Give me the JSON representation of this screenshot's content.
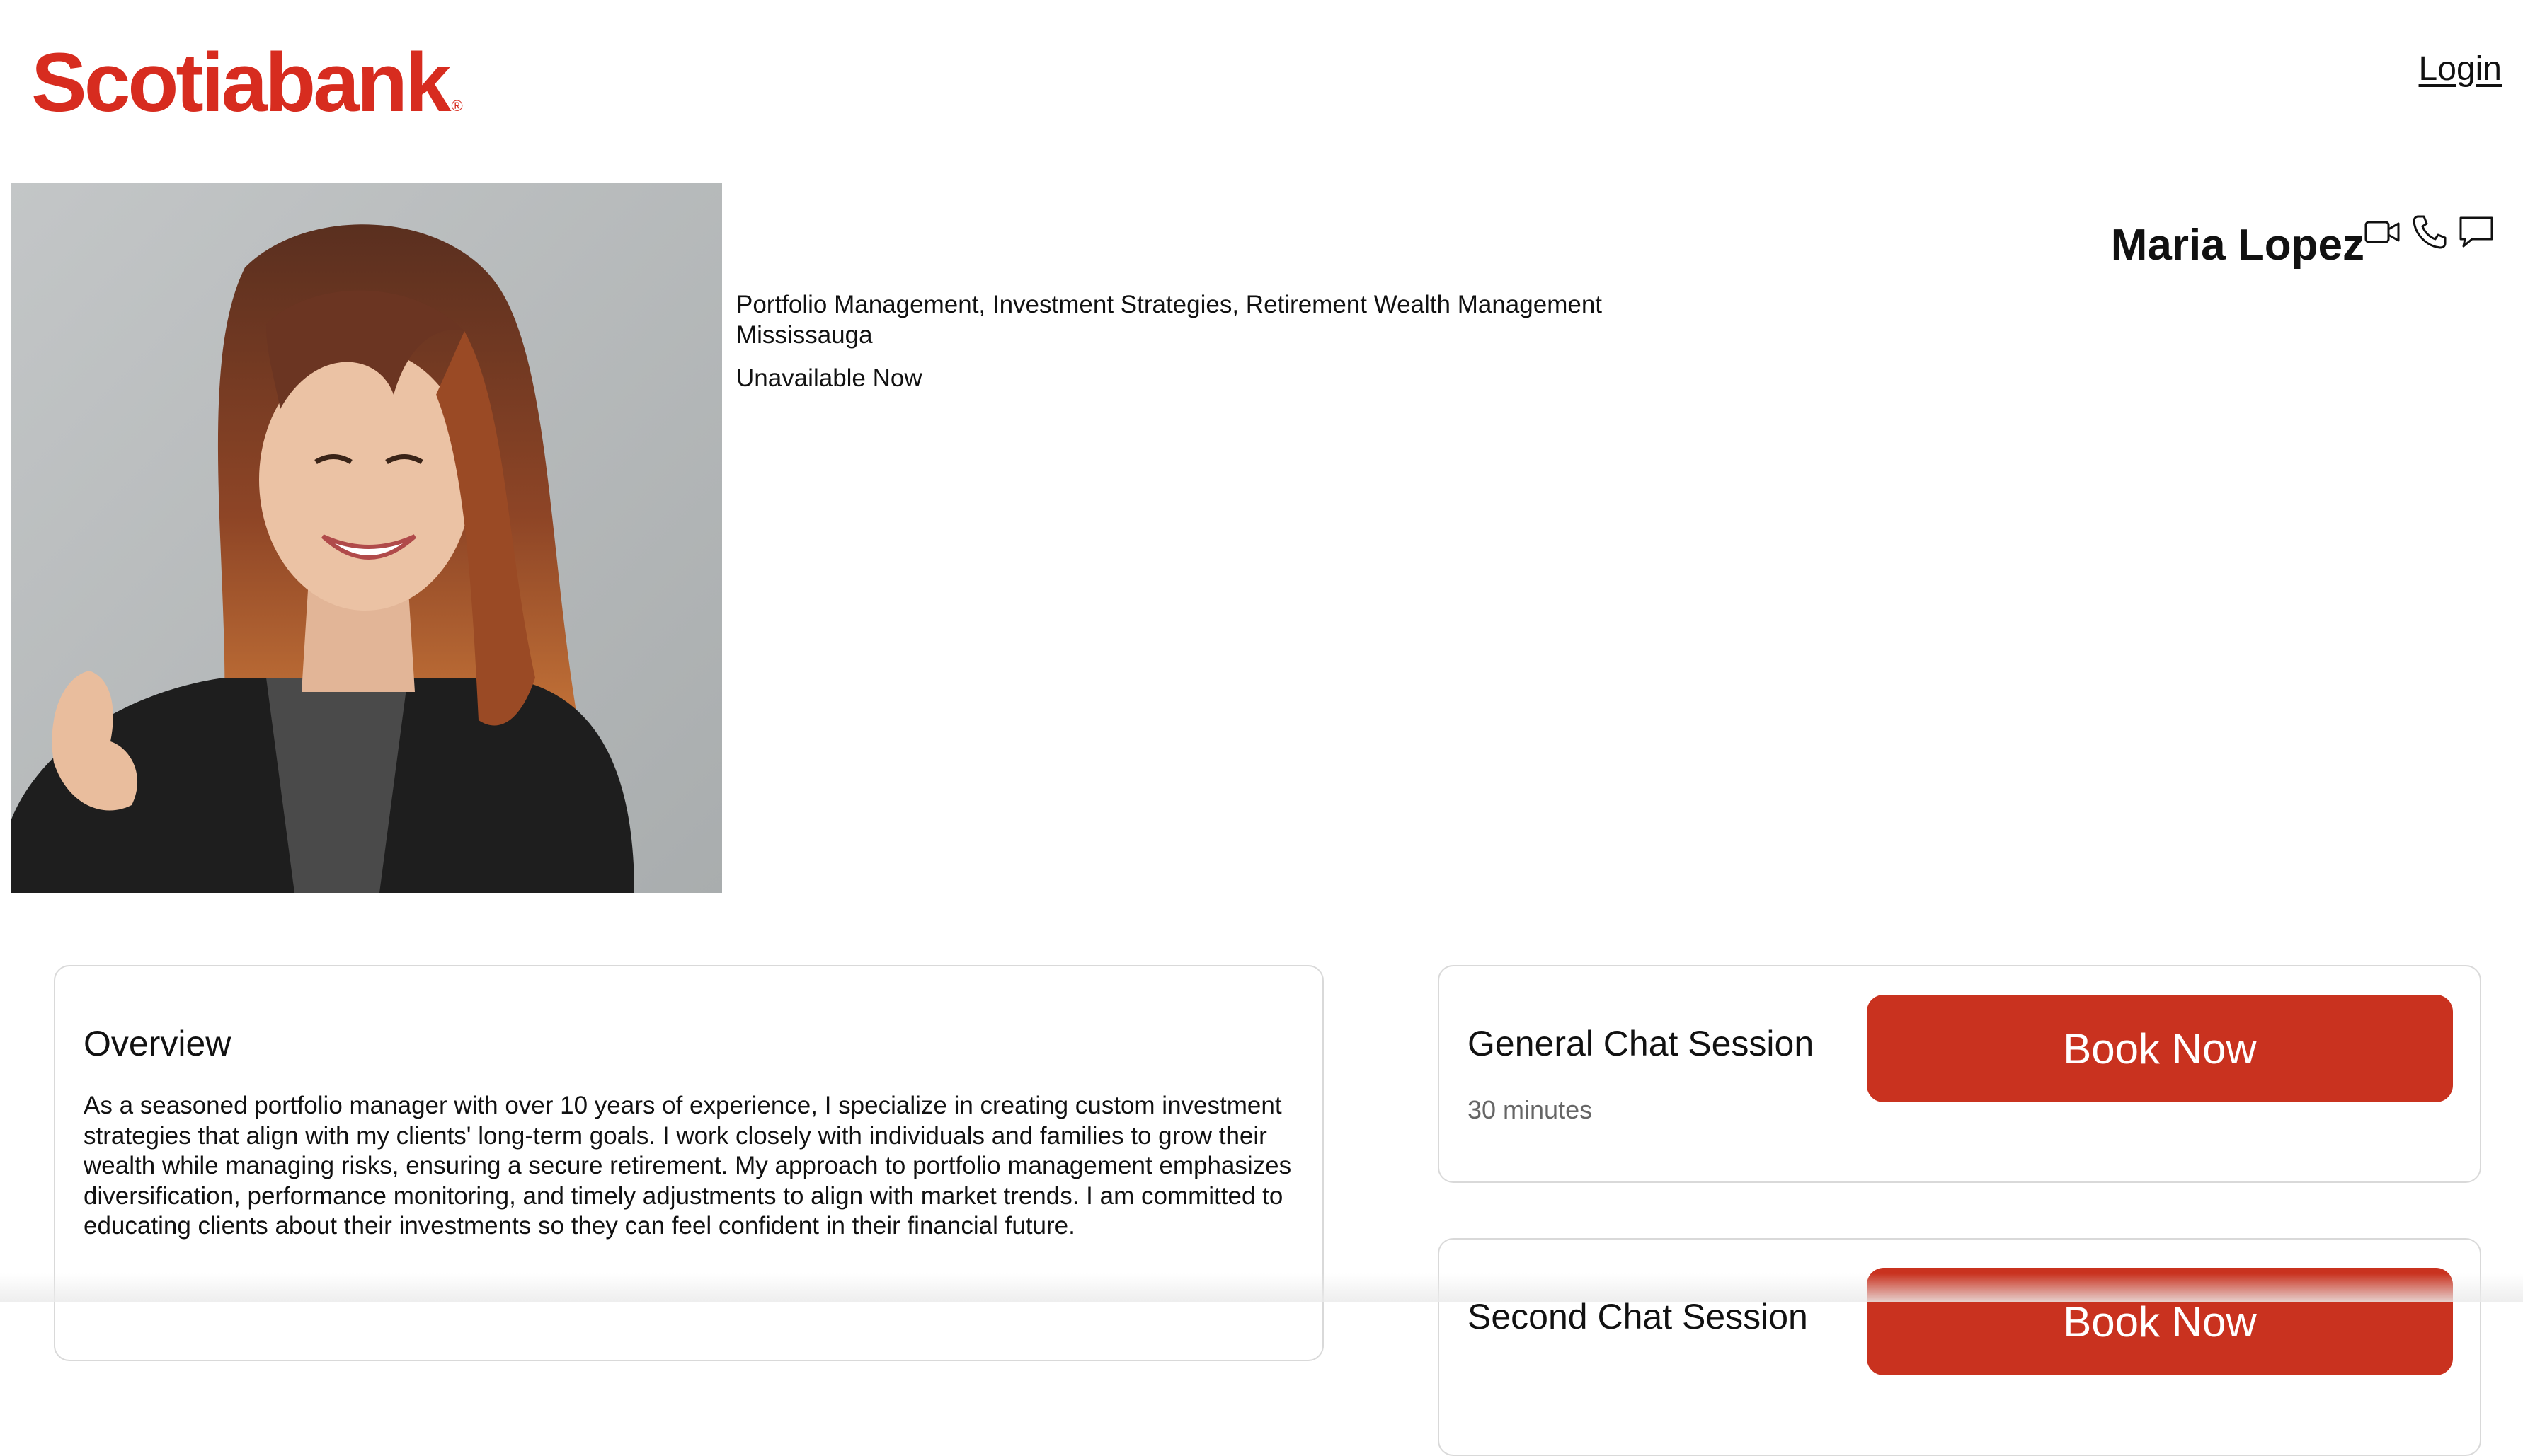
{
  "header": {
    "logo_text": "Scotiabank",
    "logo_mark": "®",
    "login_label": "Login"
  },
  "advisor": {
    "name": "Maria Lopez",
    "photo_alt": "Portrait of Maria Lopez",
    "specialties": "Portfolio Management, Investment Strategies, Retirement Wealth Management",
    "location": "Mississauga",
    "availability": "Unavailable Now",
    "contact_icons": [
      "video-icon",
      "phone-icon",
      "chat-icon"
    ]
  },
  "overview": {
    "title": "Overview",
    "body": "As a seasoned portfolio manager with over 10 years of experience, I specialize in creating custom investment strategies that align with my clients' long-term goals. I work closely with individuals and families to grow their wealth while managing risks, ensuring a secure retirement. My approach to portfolio management emphasizes diversification, performance monitoring, and timely adjustments to align with market trends. I am committed to educating clients about their investments so they can feel confident in their financial future."
  },
  "sessions": [
    {
      "title": "General Chat Session",
      "duration": "30 minutes",
      "button_label": "Book Now"
    },
    {
      "title": "Second Chat Session",
      "duration": "",
      "button_label": "Book Now"
    }
  ],
  "colors": {
    "brand_red": "#d72c1f",
    "button_red": "#c9321f",
    "card_border": "#d9d9d9",
    "muted_text": "#666666"
  }
}
